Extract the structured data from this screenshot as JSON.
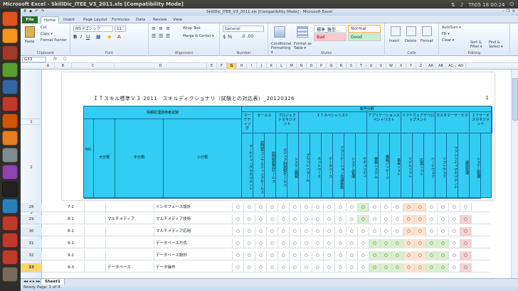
{
  "topbar": {
    "title": "Microsoft Excel - SkillDic_ITEE_V3_2011.xls  [Compatibility Mode]",
    "time": "Th05 18 00:24"
  },
  "window": {
    "title": "SkillDic_ITEE_V3_2011.xls [Compatibility Mode] - Microsoft Excel"
  },
  "tabs": [
    "File",
    "Home",
    "Insert",
    "Page Layout",
    "Formulas",
    "Data",
    "Review",
    "View"
  ],
  "ribbon": {
    "clipboard": {
      "label": "Clipboard",
      "paste": "Paste",
      "cut": "Cut",
      "copy": "Copy ▾",
      "painter": "Format Painter"
    },
    "font": {
      "label": "Font",
      "name": "MS Pゴシック",
      "size": "11"
    },
    "alignment": {
      "label": "Alignment",
      "wrap": "Wrap Text",
      "merge": "Merge & Center ▾"
    },
    "number": {
      "label": "Number",
      "format": "General"
    },
    "styles": {
      "label": "Styles",
      "cond": "Conditional Formatting ▾",
      "table": "Format as Table ▾",
      "normal_jp": "標準_雛型...",
      "normal": "Normal",
      "bad": "Bad",
      "good": "Good"
    },
    "cells": {
      "label": "Cells",
      "insert": "Insert",
      "delete": "Delete",
      "format": "Format"
    },
    "editing": {
      "label": "Editing",
      "autosum": "AutoSum ▾",
      "fill": "Fill ▾",
      "clear": "Clear ▾",
      "sort": "Sort & Filter ▾",
      "find": "Find & Select ▾"
    }
  },
  "formula": {
    "namebox": "G33",
    "fx": "fx",
    "value": "○"
  },
  "columns": [
    "A",
    "B",
    "C",
    "D",
    "E",
    "F",
    "G",
    "H",
    "I",
    "J",
    "K",
    "L",
    "M",
    "N",
    "O",
    "P",
    "Q",
    "R",
    "S",
    "T",
    "U",
    "V",
    "W",
    "X",
    "Y",
    "Z",
    "AA",
    "AB",
    "AC",
    "AD"
  ],
  "document": {
    "title": "ＩＴスキル標準Ｖ３ 2011　スキルディクショナリ（試験との対応表）_20120326",
    "page": "1",
    "header": {
      "no": "NO.",
      "group": "情報処理技術者試験",
      "major": "大分類",
      "middle": "中分類",
      "minor": "小分類",
      "specialty": "専門分野",
      "cats": [
        "マーケティング",
        "セールス",
        "プロジェクトマネジメント",
        "ＩＴスペシャリスト",
        "アプリケーションスペシャリスト",
        "ソフトウェアデベロップメント",
        "カスタマーサービス",
        "ＩＴサービスマネジメント"
      ],
      "subs": [
        "マーケティングマネジメント",
        "訪問型コンサルティングセールス",
        "訪問型製品セールス",
        "メディア利用型セールス",
        "システム開発",
        "プラットフォーム",
        "ネットワーク",
        "データベース",
        "アプリケーション共通基盤",
        "システム管理",
        "セキュリティ",
        "業務システム",
        "業務パッケージ",
        "基本ソフト",
        "ミドルソフト",
        "応用ソフト",
        "ハードウェア",
        "ソフトウェア",
        "ファシリティマネジメント",
        "運用管理",
        "システム管理"
      ]
    }
  },
  "rows": [
    {
      "rn": "28",
      "no": "7-2",
      "middle": "",
      "minor": "インタフェース設計"
    },
    {
      "rn": "29",
      "no": "8-1",
      "middle": "マルチメディア",
      "minor": "マルチメディア技術"
    },
    {
      "rn": "30",
      "no": "8-2",
      "middle": "",
      "minor": "マルチメディア応用"
    },
    {
      "rn": "31",
      "no": "9-1",
      "middle": "",
      "minor": "データベース方式"
    },
    {
      "rn": "32",
      "no": "9-2",
      "middle": "",
      "minor": "データベース設計"
    },
    {
      "rn": "33",
      "no": "9-3",
      "middle": "データベース",
      "minor": "データ操作"
    }
  ],
  "mark": "○",
  "sheet_tab": "Sheet1",
  "status": "Ready   Page: 1 of 4"
}
